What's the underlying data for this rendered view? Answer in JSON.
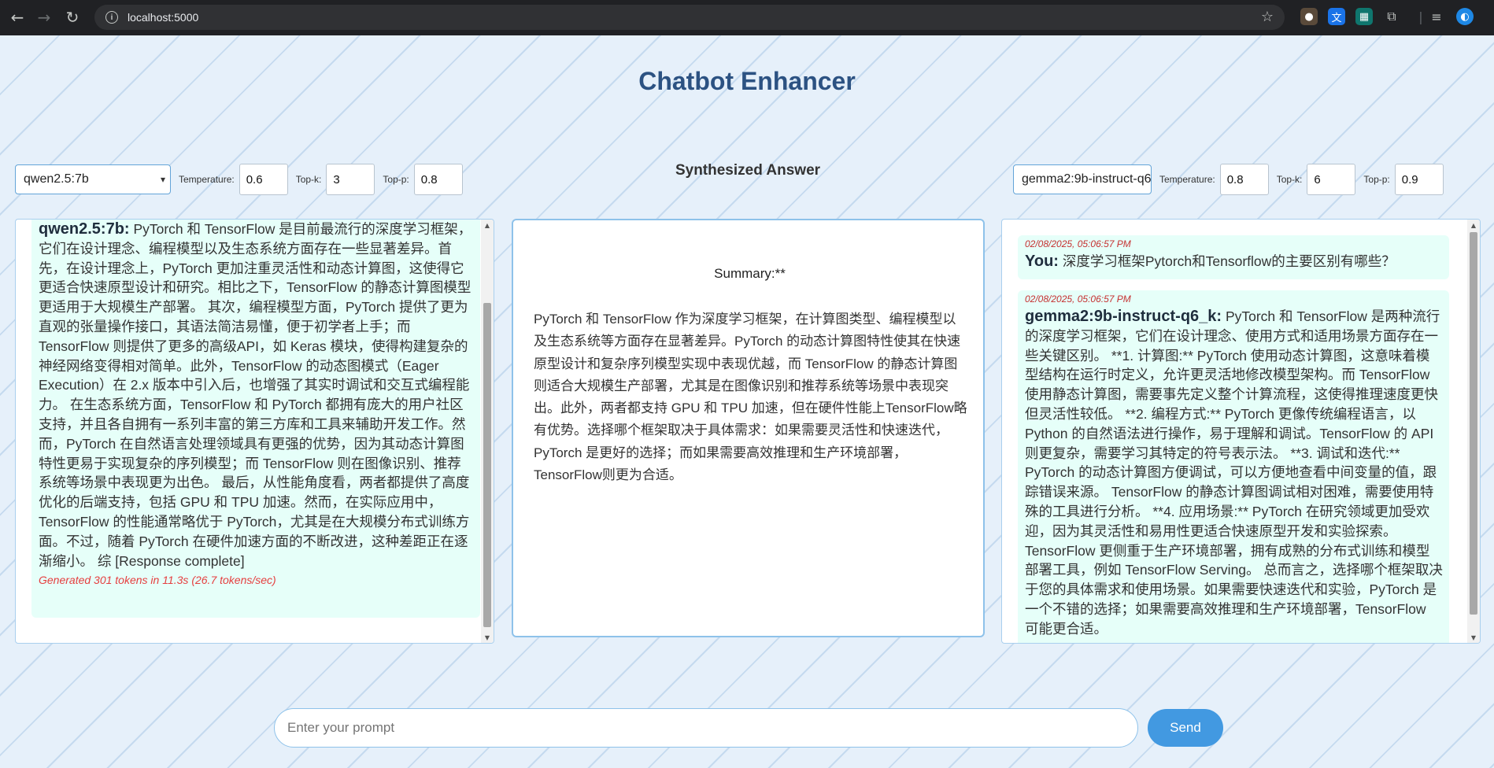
{
  "browser": {
    "url": "localhost:5000"
  },
  "app": {
    "title": "Chatbot Enhancer",
    "synth_title": "Synthesized Answer",
    "prompt_placeholder": "Enter your prompt",
    "send_label": "Send"
  },
  "left": {
    "model": "qwen2.5:7b",
    "params": [
      {
        "label": "Temperature:",
        "value": "0.6"
      },
      {
        "label": "Top-k:",
        "value": "3"
      },
      {
        "label": "Top-p:",
        "value": "0.8"
      }
    ],
    "message": {
      "sender": "qwen2.5:7b:",
      "text": "PyTorch 和 TensorFlow 是目前最流行的深度学习框架，它们在设计理念、编程模型以及生态系统方面存在一些显著差异。首先，在设计理念上，PyTorch 更加注重灵活性和动态计算图，这使得它更适合快速原型设计和研究。相比之下，TensorFlow 的静态计算图模型更适用于大规模生产部署。 其次，编程模型方面，PyTorch 提供了更为直观的张量操作接口，其语法简洁易懂，便于初学者上手；而 TensorFlow 则提供了更多的高级API，如 Keras 模块，使得构建复杂的神经网络变得相对简单。此外，TensorFlow 的动态图模式（Eager Execution）在 2.x 版本中引入后，也增强了其实时调试和交互式编程能力。 在生态系统方面，TensorFlow 和 PyTorch 都拥有庞大的用户社区支持，并且各自拥有一系列丰富的第三方库和工具来辅助开发工作。然而，PyTorch 在自然语言处理领域具有更强的优势，因为其动态计算图特性更易于实现复杂的序列模型；而 TensorFlow 则在图像识别、推荐系统等场景中表现更为出色。 最后，从性能角度看，两者都提供了高度优化的后端支持，包括 GPU 和 TPU 加速。然而，在实际应用中，TensorFlow 的性能通常略优于 PyTorch，尤其是在大规模分布式训练方面。不过，随着 PyTorch 在硬件加速方面的不断改进，这种差距正在逐渐缩小。 综 [Response complete]",
      "stats": "Generated 301 tokens in 11.3s (26.7 tokens/sec)"
    }
  },
  "middle": {
    "summary_label": "Summary:**",
    "summary_text": "PyTorch 和 TensorFlow 作为深度学习框架，在计算图类型、编程模型以及生态系统等方面存在显著差异。PyTorch 的动态计算图特性使其在快速原型设计和复杂序列模型实现中表现优越，而 TensorFlow 的静态计算图则适合大规模生产部署，尤其是在图像识别和推荐系统等场景中表现突出。此外，两者都支持 GPU 和 TPU 加速，但在硬件性能上TensorFlow略有优势。选择哪个框架取决于具体需求：如果需要灵活性和快速迭代，PyTorch 是更好的选择；而如果需要高效推理和生产环境部署，TensorFlow则更为合适。"
  },
  "right": {
    "model": "gemma2:9b-instruct-q6",
    "params": [
      {
        "label": "Temperature:",
        "value": "0.8"
      },
      {
        "label": "Top-k:",
        "value": "6"
      },
      {
        "label": "Top-p:",
        "value": "0.9"
      }
    ],
    "user_message": {
      "timestamp": "02/08/2025, 05:06:57 PM",
      "sender": "You:",
      "text": "深度学习框架Pytorch和Tensorflow的主要区别有哪些？"
    },
    "bot_message": {
      "timestamp": "02/08/2025, 05:06:57 PM",
      "sender": "gemma2:9b-instruct-q6_k:",
      "text": "PyTorch 和 TensorFlow 是两种流行的深度学习框架，它们在设计理念、使用方式和适用场景方面存在一些关键区别。 **1. 计算图:** PyTorch 使用动态计算图，这意味着模型结构在运行时定义，允许更灵活地修改模型架构。而 TensorFlow 使用静态计算图，需要事先定义整个计算流程，这使得推理速度更快但灵活性较低。 **2. 编程方式:** PyTorch 更像传统编程语言，以 Python 的自然语法进行操作，易于理解和调试。TensorFlow 的 API 则更复杂，需要学习其特定的符号表示法。 **3. 调试和迭代:** PyTorch 的动态计算图方便调试，可以方便地查看中间变量的值，跟踪错误来源。 TensorFlow 的静态计算图调试相对困难，需要使用特殊的工具进行分析。 **4. 应用场景:** PyTorch 在研究领域更加受欢迎，因为其灵活性和易用性更适合快速原型开发和实验探索。TensorFlow 更侧重于生产环境部署，拥有成熟的分布式训练和模型部署工具，例如 TensorFlow Serving。 总而言之，选择哪个框架取决于您的具体需求和使用场景。如果需要快速迭代和实验，PyTorch 是一个不错的选择；如果需要高效推理和生产环境部署，TensorFlow 可能更合适。"
    }
  },
  "icons": {
    "back": "←",
    "forward": "→",
    "reload": "↻",
    "info": "i",
    "star": "☆",
    "caret": "▾"
  }
}
